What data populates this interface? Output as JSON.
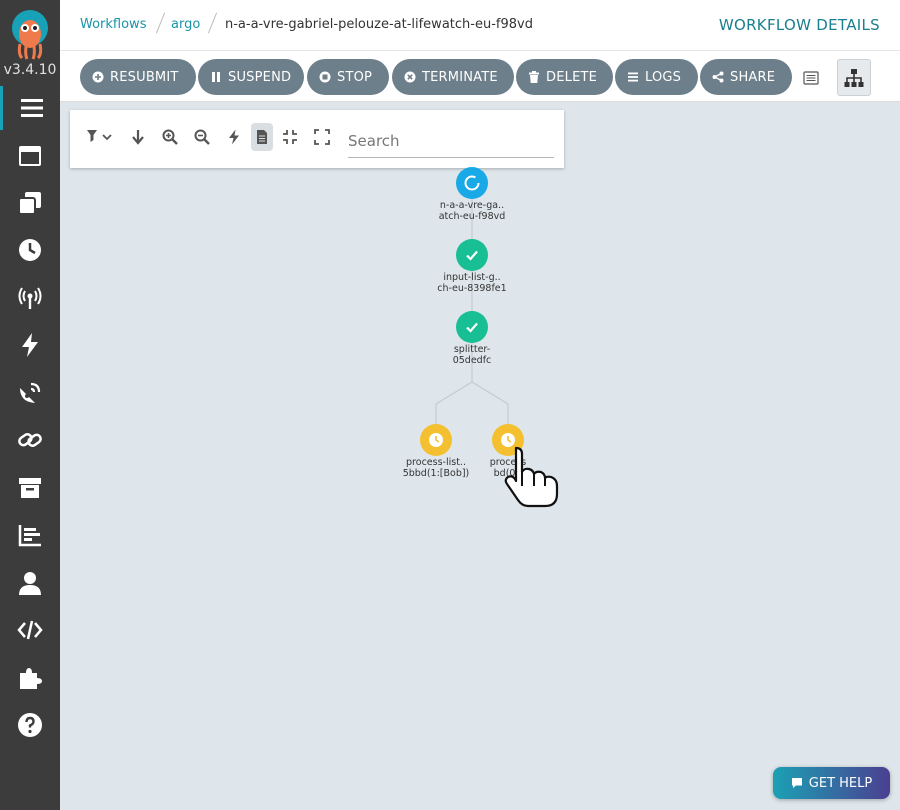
{
  "app": {
    "version": "v3.4.10"
  },
  "breadcrumbs": [
    {
      "label": "Workflows"
    },
    {
      "label": "argo"
    },
    {
      "label": "n-a-a-vre-gabriel-pelouze-at-lifewatch-eu-f98vd"
    }
  ],
  "header": {
    "title": "WORKFLOW DETAILS"
  },
  "toolbar": {
    "buttons": [
      {
        "label": "RESUBMIT",
        "icon": "plus-circle-icon"
      },
      {
        "label": "SUSPEND",
        "icon": "pause-icon"
      },
      {
        "label": "STOP",
        "icon": "stop-circle-icon"
      },
      {
        "label": "TERMINATE",
        "icon": "times-circle-icon"
      },
      {
        "label": "DELETE",
        "icon": "trash-icon"
      },
      {
        "label": "LOGS",
        "icon": "bars-icon"
      },
      {
        "label": "SHARE",
        "icon": "share-icon"
      }
    ]
  },
  "graph_panel": {
    "search_placeholder": "Search"
  },
  "nodes": [
    {
      "name": "n-a-a-vre-ga..",
      "name2": "atch-eu-f98vd",
      "status": "running",
      "color": "#18a9e6"
    },
    {
      "name": "input-list-g..",
      "name2": "ch-eu-8398fe1",
      "status": "succeeded",
      "color": "#18be94"
    },
    {
      "name": "splitter-",
      "name2": "05dedfc",
      "status": "succeeded",
      "color": "#18be94"
    },
    {
      "name": "process-list..",
      "name2": "5bbd(1:[Bob])",
      "status": "pending",
      "color": "#f4c030"
    },
    {
      "name": "process",
      "name2": "bd(0:[",
      "status": "pending",
      "color": "#f4c030"
    }
  ],
  "help": {
    "label": "GET HELP"
  },
  "colors": {
    "sidebar": "#3c3c3c",
    "accent": "#1994a8",
    "button": "#6d7f8b",
    "canvas": "#dee6eb"
  }
}
